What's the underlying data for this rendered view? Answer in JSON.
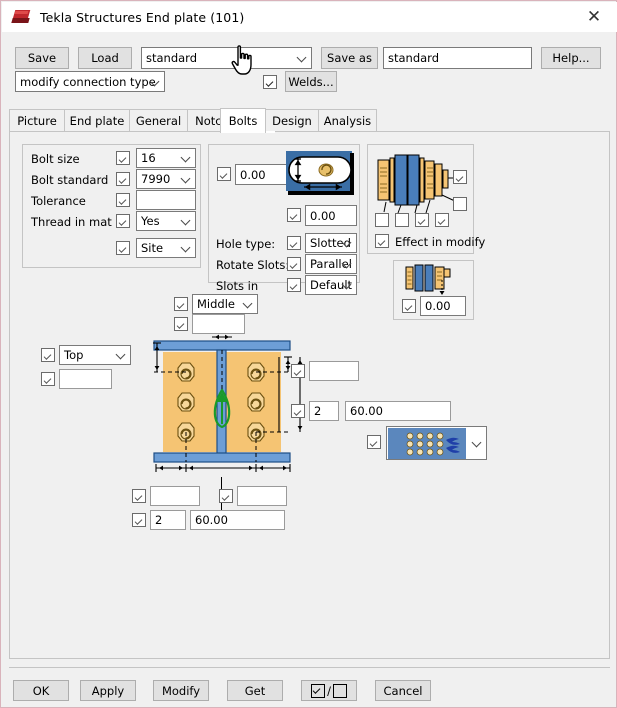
{
  "window": {
    "title": "Tekla Structures  End plate (101)",
    "close_label": "✕",
    "logo_icon": "tekla-logo-icon"
  },
  "toolbar": {
    "save_label": "Save",
    "load_label": "Load",
    "preset_value": "standard",
    "save_as_label": "Save as",
    "save_as_value": "standard",
    "help_label": "Help...",
    "connection_type_value": "modify connection type",
    "welds_label": "Welds...",
    "welds_checked": true
  },
  "tabs": [
    {
      "label": "Picture",
      "selected": false
    },
    {
      "label": "End plate",
      "selected": false
    },
    {
      "label": "General",
      "selected": false
    },
    {
      "label": "Notch",
      "selected": false
    },
    {
      "label": "Bolts",
      "selected": true
    },
    {
      "label": "Design",
      "selected": false
    },
    {
      "label": "Analysis",
      "selected": false
    }
  ],
  "bolt_group": {
    "rows": [
      {
        "label": "Bolt size",
        "checked": true,
        "value": "16",
        "type": "dropdown"
      },
      {
        "label": "Bolt standard",
        "checked": true,
        "value": "7990",
        "type": "dropdown"
      },
      {
        "label": "Tolerance",
        "checked": true,
        "value": "",
        "type": "text"
      },
      {
        "label": "Thread in mat",
        "checked": true,
        "value": "Yes",
        "type": "dropdown"
      },
      {
        "label": "",
        "checked": true,
        "value": "Site",
        "type": "dropdown"
      }
    ]
  },
  "hole_group": {
    "slot_x_checked": true,
    "slot_x_value": "0.00",
    "slot_y_checked": true,
    "slot_y_value": "0.00",
    "slot_preview_icon": "slotted-hole-icon",
    "rows": [
      {
        "label": "Hole type:",
        "checked": true,
        "value": "Slotted"
      },
      {
        "label": "Rotate Slots:",
        "checked": true,
        "value": "Parallel"
      },
      {
        "label": "Slots in",
        "checked": true,
        "value": "Default"
      }
    ]
  },
  "effect_group": {
    "title": "Effect in modify",
    "title_checked": true,
    "assembly_icon": "bolt-assembly-icon",
    "right_checks": [
      true,
      false
    ],
    "bottom_checks": [
      false,
      false,
      true,
      true
    ]
  },
  "edge_group": {
    "icon": "plate-edge-distance-icon",
    "checked": true,
    "value": "0.00"
  },
  "diagram": {
    "picture_icon": "end-plate-bolt-diagram-icon",
    "top_position": {
      "checked": true,
      "value": "Middle",
      "type": "dropdown"
    },
    "top_offset": {
      "checked": true,
      "value": "",
      "type": "text"
    },
    "left_position": {
      "checked": true,
      "value": "Top",
      "type": "dropdown"
    },
    "left_offset": {
      "checked": true,
      "value": "",
      "type": "text"
    },
    "right_edge": {
      "checked": true,
      "value": ""
    },
    "right_count": {
      "checked": true,
      "count": "2",
      "spacing": "60.00"
    },
    "bottom_left_edge": {
      "checked": true,
      "value": ""
    },
    "bottom_right_edge": {
      "checked": true,
      "value": ""
    },
    "bottom_count": {
      "checked": true,
      "count": "2",
      "spacing": "60.00"
    },
    "bolt_pattern": {
      "checked": true,
      "icon": "bolt-group-pattern-icon"
    }
  },
  "footer": {
    "ok_label": "OK",
    "apply_label": "Apply",
    "modify_label": "Modify",
    "get_label": "Get",
    "toggle_label": "/",
    "cancel_label": "Cancel"
  },
  "colors": {
    "accent_blue": "#4a7ebb",
    "plate_orange": "#f5c473",
    "selection_blue": "#3a6ea5",
    "green": "#1a9a2a"
  }
}
